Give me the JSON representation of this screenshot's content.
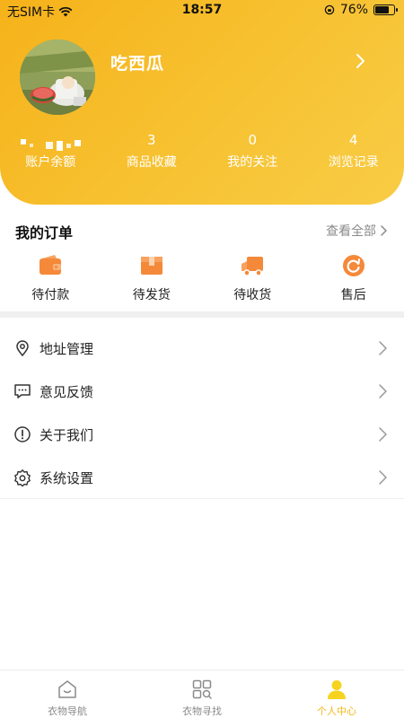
{
  "status_bar": {
    "carrier": "无SIM卡",
    "time": "18:57",
    "battery": "76%",
    "battery_level": 0.76
  },
  "profile": {
    "username": "吃西瓜"
  },
  "stats": [
    {
      "value": "",
      "label": "账户余额"
    },
    {
      "value": "3",
      "label": "商品收藏"
    },
    {
      "value": "0",
      "label": "我的关注"
    },
    {
      "value": "4",
      "label": "浏览记录"
    }
  ],
  "orders": {
    "title": "我的订单",
    "view_all": "查看全部",
    "items": [
      {
        "label": "待付款",
        "icon": "wallet-icon"
      },
      {
        "label": "待发货",
        "icon": "package-icon"
      },
      {
        "label": "待收货",
        "icon": "truck-icon"
      },
      {
        "label": "售后",
        "icon": "refund-icon"
      }
    ]
  },
  "menu": [
    {
      "label": "地址管理",
      "icon": "location-pin-icon"
    },
    {
      "label": "意见反馈",
      "icon": "chat-feedback-icon"
    },
    {
      "label": "关于我们",
      "icon": "info-alert-icon"
    },
    {
      "label": "系统设置",
      "icon": "gear-icon"
    }
  ],
  "tabbar": [
    {
      "label": "衣物导航",
      "icon": "home-icon",
      "active": false
    },
    {
      "label": "衣物寻找",
      "icon": "grid-search-icon",
      "active": false
    },
    {
      "label": "个人中心",
      "icon": "person-icon",
      "active": true
    }
  ],
  "colors": {
    "accent": "#f7c232",
    "orange_icon": "#f5893a",
    "tab_active": "#f5b815"
  }
}
